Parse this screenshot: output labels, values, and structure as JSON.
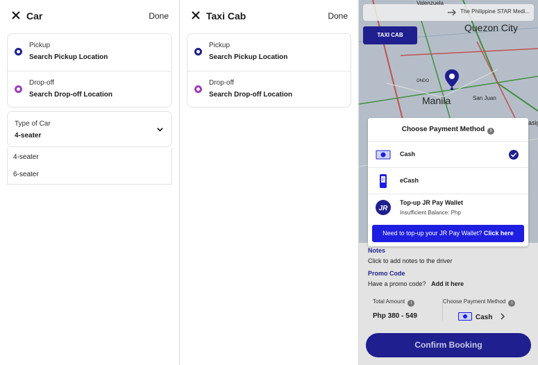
{
  "car_panel": {
    "title": "Car",
    "done_label": "Done",
    "pickup_label": "Pickup",
    "pickup_value": "Search Pickup Location",
    "dropoff_label": "Drop-off",
    "dropoff_value": "Search Drop-off Location",
    "type_label": "Type of Car",
    "type_value": "4-seater",
    "type_options": [
      "4-seater",
      "6-seater"
    ]
  },
  "taxi_panel": {
    "title": "Taxi Cab",
    "done_label": "Done",
    "pickup_label": "Pickup",
    "pickup_value": "Search Pickup Location",
    "dropoff_label": "Drop-off",
    "dropoff_value": "Search Drop-off Location"
  },
  "booking_panel": {
    "map": {
      "search_text": "The Philippine STAR Medi...",
      "top_place": "Valenzuela",
      "taxi_button": "TAXI CAB",
      "labels": [
        "Quezon City",
        "Manila",
        "San Juan",
        "ONDO",
        "asig"
      ]
    },
    "payment_modal": {
      "title": "Choose Payment Method",
      "info_icon": "i",
      "options": [
        {
          "name": "Cash",
          "selected": true
        },
        {
          "name": "eCash",
          "selected": false
        },
        {
          "name": "Top-up JR Pay Wallet",
          "subtext": "Insufficient Balance: Php",
          "selected": false
        }
      ],
      "topup_text": "Need to top-up your JR Pay Wallet?",
      "topup_link": "Click here"
    },
    "notes_title": "Notes",
    "notes_text": "Click to add notes to the driver",
    "promo_title": "Promo Code",
    "promo_text": "Have a promo code?",
    "promo_link": "Add it here",
    "total_label": "Total Amount",
    "total_value": "Php 380 - 549",
    "method_label": "Choose Payment Method",
    "method_value": "Cash",
    "confirm_button": "Confirm Booking",
    "colors": {
      "primary": "#1f1f8f",
      "accent": "#1e1ee0",
      "purple": "#9b3fb8"
    }
  }
}
